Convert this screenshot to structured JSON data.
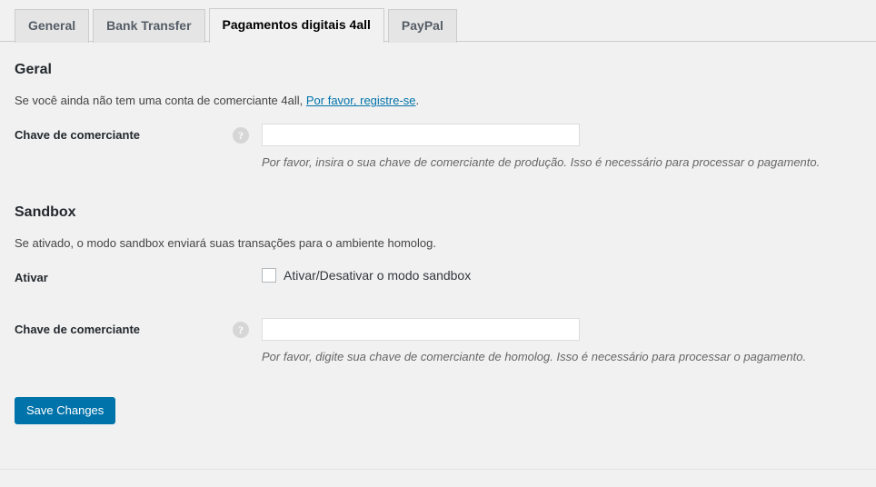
{
  "tabs": [
    {
      "label": "General",
      "active": false
    },
    {
      "label": "Bank Transfer",
      "active": false
    },
    {
      "label": "Pagamentos digitais 4all",
      "active": true
    },
    {
      "label": "PayPal",
      "active": false
    }
  ],
  "sections": {
    "geral": {
      "title": "Geral",
      "description_prefix": "Se você ainda não tem uma conta de comerciante 4all, ",
      "description_link": "Por favor, registre-se",
      "description_suffix": ".",
      "merchant_key": {
        "label": "Chave de comerciante",
        "help_icon": "question-mark-icon",
        "value": "",
        "placeholder": "",
        "description": "Por favor, insira o sua chave de comerciante de produção. Isso é necessário para processar o pagamento."
      }
    },
    "sandbox": {
      "title": "Sandbox",
      "description": "Se ativado, o modo sandbox enviará suas transações para o ambiente homolog.",
      "enable": {
        "label": "Ativar",
        "checkbox_label": "Ativar/Desativar o modo sandbox",
        "checked": false
      },
      "merchant_key": {
        "label": "Chave de comerciante",
        "help_icon": "question-mark-icon",
        "value": "",
        "placeholder": "",
        "description": "Por favor, digite sua chave de comerciante de homolog. Isso é necessário para processar o pagamento."
      }
    }
  },
  "submit": {
    "save_label": "Save Changes"
  },
  "icons": {
    "help": "?"
  },
  "colors": {
    "accent_blue": "#0073aa",
    "page_background": "#f1f1f1",
    "tab_inactive_background": "#e5e5e5",
    "border_gray": "#cccccc",
    "heading_text": "#23282d",
    "muted_text": "#666666"
  }
}
